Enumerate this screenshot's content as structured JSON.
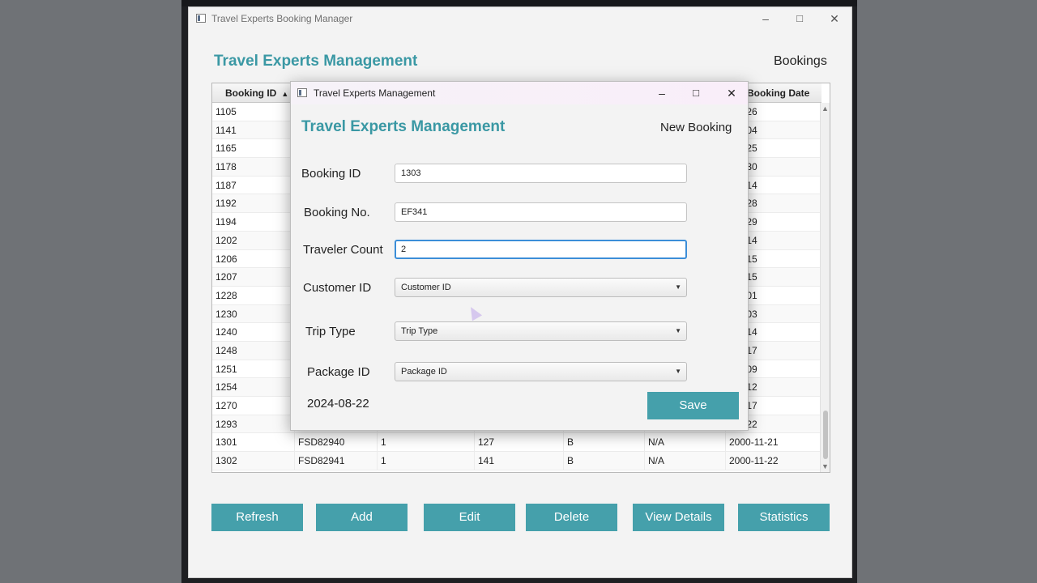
{
  "main_window": {
    "title": "Travel Experts Booking Manager",
    "app_title": "Travel Experts Management",
    "page_label": "Bookings",
    "controls": {
      "minimize": "–",
      "maximize": "□",
      "close": "✕"
    }
  },
  "table": {
    "columns": [
      "Booking ID",
      "Booking Date"
    ],
    "sort_indicator": "▲",
    "rows": [
      {
        "id": "1105",
        "date": "-04-26",
        "no": "",
        "count": "",
        "cust": "",
        "type": "",
        "pkg": ""
      },
      {
        "id": "1141",
        "date": "-05-04",
        "no": "",
        "count": "",
        "cust": "",
        "type": "",
        "pkg": ""
      },
      {
        "id": "1165",
        "date": "-05-25",
        "no": "",
        "count": "",
        "cust": "",
        "type": "",
        "pkg": ""
      },
      {
        "id": "1178",
        "date": "-05-30",
        "no": "",
        "count": "",
        "cust": "",
        "type": "",
        "pkg": ""
      },
      {
        "id": "1187",
        "date": "-06-14",
        "no": "",
        "count": "",
        "cust": "",
        "type": "",
        "pkg": ""
      },
      {
        "id": "1192",
        "date": "-06-28",
        "no": "",
        "count": "",
        "cust": "",
        "type": "",
        "pkg": ""
      },
      {
        "id": "1194",
        "date": "-06-29",
        "no": "",
        "count": "",
        "cust": "",
        "type": "",
        "pkg": ""
      },
      {
        "id": "1202",
        "date": "-07-14",
        "no": "",
        "count": "",
        "cust": "",
        "type": "",
        "pkg": ""
      },
      {
        "id": "1206",
        "date": "-07-15",
        "no": "",
        "count": "",
        "cust": "",
        "type": "",
        "pkg": ""
      },
      {
        "id": "1207",
        "date": "-07-15",
        "no": "",
        "count": "",
        "cust": "",
        "type": "",
        "pkg": ""
      },
      {
        "id": "1228",
        "date": "-08-01",
        "no": "",
        "count": "",
        "cust": "",
        "type": "",
        "pkg": ""
      },
      {
        "id": "1230",
        "date": "-08-03",
        "no": "",
        "count": "",
        "cust": "",
        "type": "",
        "pkg": ""
      },
      {
        "id": "1240",
        "date": "-08-14",
        "no": "",
        "count": "",
        "cust": "",
        "type": "",
        "pkg": ""
      },
      {
        "id": "1248",
        "date": "-08-17",
        "no": "",
        "count": "",
        "cust": "",
        "type": "",
        "pkg": ""
      },
      {
        "id": "1251",
        "date": "-09-09",
        "no": "",
        "count": "",
        "cust": "",
        "type": "",
        "pkg": ""
      },
      {
        "id": "1254",
        "date": "-09-12",
        "no": "",
        "count": "",
        "cust": "",
        "type": "",
        "pkg": ""
      },
      {
        "id": "1270",
        "date": "-10-17",
        "no": "",
        "count": "",
        "cust": "",
        "type": "",
        "pkg": ""
      },
      {
        "id": "1293",
        "date": "-10-22",
        "no": "",
        "count": "",
        "cust": "",
        "type": "",
        "pkg": ""
      },
      {
        "id": "1301",
        "date": "2000-11-21",
        "no": "FSD82940",
        "count": "1",
        "cust": "127",
        "type": "B",
        "pkg": "N/A"
      },
      {
        "id": "1302",
        "date": "2000-11-22",
        "no": "FSD82941",
        "count": "1",
        "cust": "141",
        "type": "B",
        "pkg": "N/A"
      }
    ]
  },
  "buttons": {
    "refresh": "Refresh",
    "add": "Add",
    "edit": "Edit",
    "delete": "Delete",
    "view_details": "View Details",
    "statistics": "Statistics"
  },
  "dialog": {
    "title": "Travel Experts Management",
    "app_title": "Travel Experts Management",
    "page_label": "New Booking",
    "booking_id_label": "Booking ID",
    "booking_id_value": "1303",
    "booking_no_label": "Booking No.",
    "booking_no_value": "EF341",
    "traveler_count_label": "Traveler Count",
    "traveler_count_value": "2",
    "customer_id_label": "Customer ID",
    "customer_id_value": "Customer ID",
    "trip_type_label": "Trip Type",
    "trip_type_value": "Trip Type",
    "package_id_label": "Package ID",
    "package_id_value": "Package ID",
    "date": "2024-08-22",
    "save": "Save",
    "combo_caret": "▼"
  }
}
